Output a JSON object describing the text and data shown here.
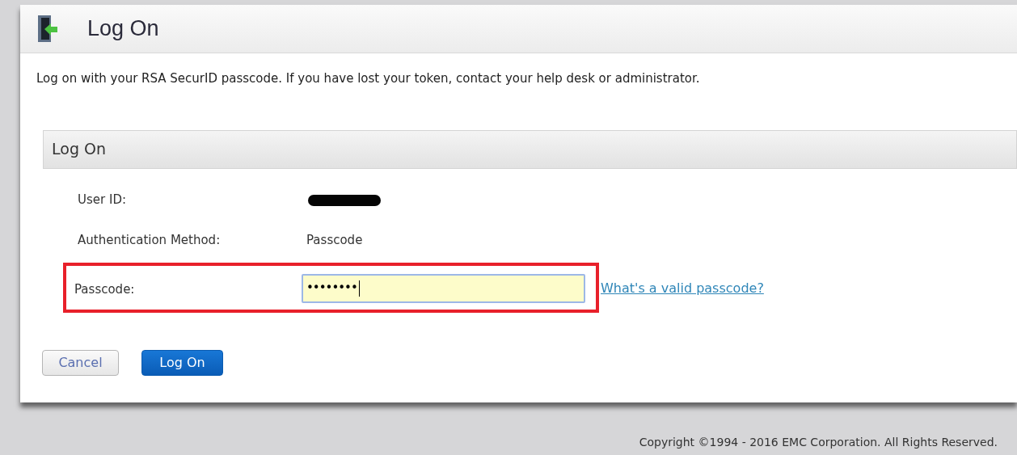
{
  "header": {
    "title": "Log On"
  },
  "description": "Log on with your RSA SecurID passcode. If you have lost your token, contact your help desk or administrator.",
  "section": {
    "title": "Log On"
  },
  "fields": [
    {
      "label": "User ID:",
      "kind": "redacted",
      "highlighted": false
    },
    {
      "label": "Authentication Method:",
      "kind": "text",
      "value": "Passcode",
      "highlighted": false
    },
    {
      "label": "Passcode:",
      "kind": "password",
      "value": "••••••••",
      "highlighted": true,
      "help_link": "What's a valid passcode?"
    }
  ],
  "buttons": [
    {
      "label": "Cancel",
      "kind": "secondary"
    },
    {
      "label": "Log On",
      "kind": "primary"
    }
  ],
  "copyright": "Copyright ©1994 - 2016 EMC Corporation. All Rights Reserved."
}
